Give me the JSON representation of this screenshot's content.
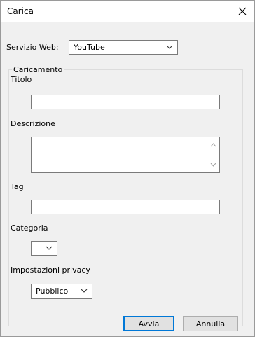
{
  "window": {
    "title": "Carica"
  },
  "service": {
    "label": "Servizio Web:",
    "selected": "YouTube"
  },
  "group": {
    "legend": "Caricamento"
  },
  "fields": {
    "title_label": "Titolo",
    "title_value": "",
    "description_label": "Descrizione",
    "description_value": "",
    "tag_label": "Tag",
    "tag_value": "",
    "category_label": "Categoria",
    "category_selected": "",
    "privacy_label": "Impostazioni privacy",
    "privacy_selected": "Pubblico"
  },
  "buttons": {
    "start": "Avvia",
    "cancel": "Annulla"
  },
  "icons": {
    "close": "close-icon",
    "chevron": "chevron-down-icon",
    "scroll_up": "chevron-up-icon",
    "scroll_down": "chevron-down-icon"
  },
  "colors": {
    "window_bg": "#f0f0f0",
    "default_button_border": "#0078d7"
  }
}
